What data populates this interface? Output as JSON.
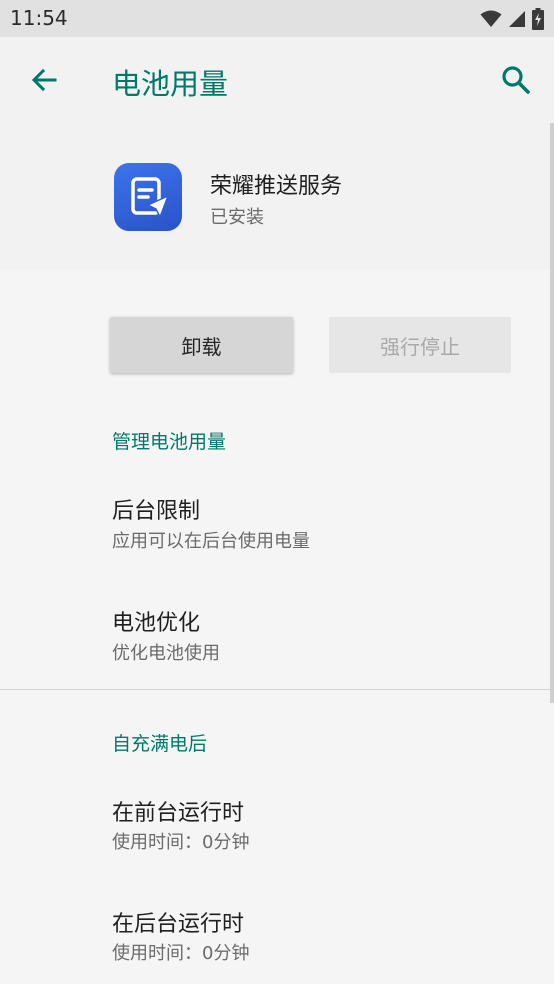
{
  "status_bar": {
    "time": "11:54",
    "icons": [
      "wifi-icon",
      "signal-icon",
      "battery-icon"
    ]
  },
  "app_bar": {
    "title": "电池用量",
    "back_icon": "arrow-left-icon",
    "search_icon": "search-icon"
  },
  "app_info": {
    "name": "荣耀推送服务",
    "status": "已安装",
    "icon": "app-push-icon"
  },
  "buttons": {
    "uninstall": "卸载",
    "force_stop": "强行停止"
  },
  "sections": [
    {
      "title": "管理电池用量",
      "items": [
        {
          "title": "后台限制",
          "summary": "应用可以在后台使用电量"
        },
        {
          "title": "电池优化",
          "summary": "优化电池使用"
        }
      ]
    },
    {
      "title": "自充满电后",
      "items": [
        {
          "title": "在前台运行时",
          "summary": "使用时间：0分钟"
        },
        {
          "title": "在后台运行时",
          "summary": "使用时间：0分钟"
        }
      ]
    }
  ],
  "colors": {
    "accent": "#00796b",
    "app_icon": "#2f5fd8"
  }
}
